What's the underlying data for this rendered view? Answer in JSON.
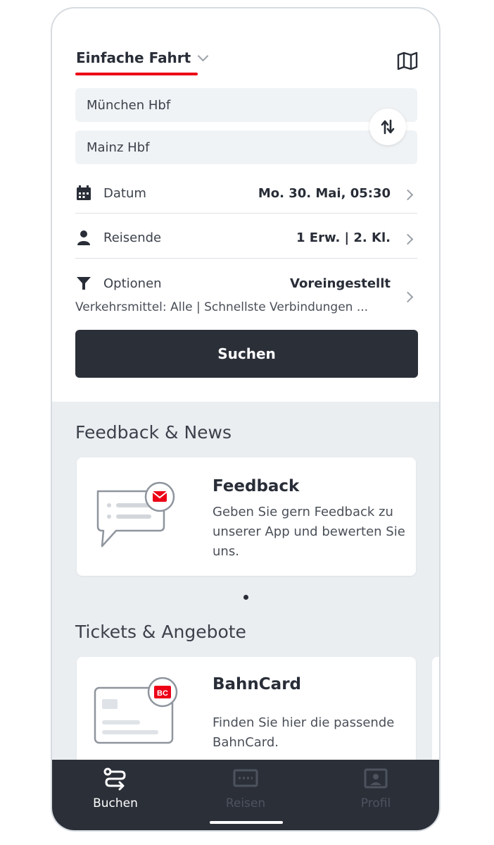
{
  "trip_type": {
    "label": "Einfache Fahrt",
    "chevron_icon": "chevron-down-icon"
  },
  "header": {
    "map_icon": "map-icon"
  },
  "stations": {
    "from": "München Hbf",
    "to": "Mainz Hbf",
    "swap_icon": "swap-arrows-icon"
  },
  "rows": {
    "datum": {
      "label": "Datum",
      "value": "Mo. 30. Mai, 05:30",
      "icon": "calendar-icon"
    },
    "reisende": {
      "label": "Reisende",
      "value": "1 Erw. | 2. Kl.",
      "icon": "person-icon"
    },
    "optionen": {
      "label": "Optionen",
      "value": "Voreingestellt",
      "subtitle": "Verkehrsmittel: Alle | Schnellste Verbindungen ...",
      "icon": "filter-icon"
    }
  },
  "search": {
    "label": "Suchen"
  },
  "feedback_section": {
    "title": "Feedback & News",
    "card": {
      "title": "Feedback",
      "description": "Geben Sie gern Feedback zu unserer App und bewerten Sie uns.",
      "icon": "chat-mail-icon"
    }
  },
  "tickets_section": {
    "title": "Tickets & Angebote",
    "card": {
      "title": "BahnCard",
      "description": "Finden Sie hier die passende BahnCard.",
      "icon": "bahncard-icon",
      "badge": "BC"
    }
  },
  "nav": {
    "items": [
      {
        "label": "Buchen",
        "icon": "route-icon",
        "active": true
      },
      {
        "label": "Reisen",
        "icon": "ticket-icon",
        "active": false
      },
      {
        "label": "Profil",
        "icon": "profile-icon",
        "active": false
      }
    ]
  },
  "colors": {
    "accent": "#ec0016",
    "dark": "#2b2f38",
    "grey_bg": "#ebeef1"
  }
}
